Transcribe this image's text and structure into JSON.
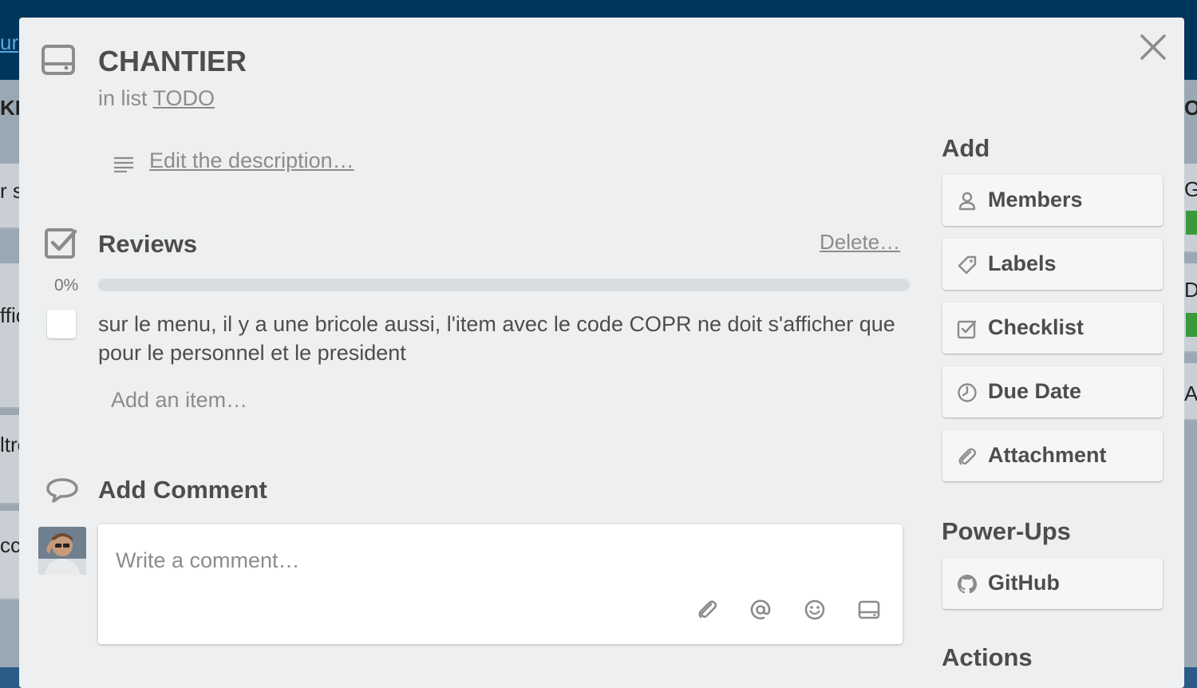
{
  "background": {
    "left_fragments": [
      "ur",
      "KL",
      "r s",
      "ffic",
      "ltre",
      "cc"
    ],
    "right_fragments": [
      "OC",
      "G",
      "D",
      "Ad"
    ]
  },
  "card": {
    "title": "CHANTIER",
    "in_list_prefix": "in list",
    "list_name": "TODO",
    "description_placeholder": "Edit the description…"
  },
  "checklist": {
    "title": "Reviews",
    "delete_label": "Delete…",
    "percent_label": "0%",
    "progress": 0,
    "items": [
      {
        "text": "sur le menu, il y a une bricole aussi, l'item avec le code COPR ne doit s'afficher que pour le personnel et le president",
        "checked": false
      }
    ],
    "add_item_placeholder": "Add an item…"
  },
  "comment": {
    "title": "Add Comment",
    "placeholder": "Write a comment…",
    "tools": [
      "attachment-icon",
      "mention-icon",
      "emoji-icon",
      "card-icon"
    ]
  },
  "sidebar": {
    "add_heading": "Add",
    "add_buttons": [
      {
        "label": "Members",
        "icon": "person-icon"
      },
      {
        "label": "Labels",
        "icon": "tag-icon"
      },
      {
        "label": "Checklist",
        "icon": "checklist-icon"
      },
      {
        "label": "Due Date",
        "icon": "clock-icon"
      },
      {
        "label": "Attachment",
        "icon": "paperclip-icon"
      }
    ],
    "powerups_heading": "Power-Ups",
    "powerups": [
      {
        "label": "GitHub",
        "icon": "github-icon"
      }
    ],
    "actions_heading": "Actions"
  },
  "colors": {
    "header_bg": "#00365b",
    "modal_bg": "#edeff0",
    "text_dark": "#4d4d4d",
    "text_muted": "#8c8c8c",
    "progress_track": "#dadde0"
  }
}
